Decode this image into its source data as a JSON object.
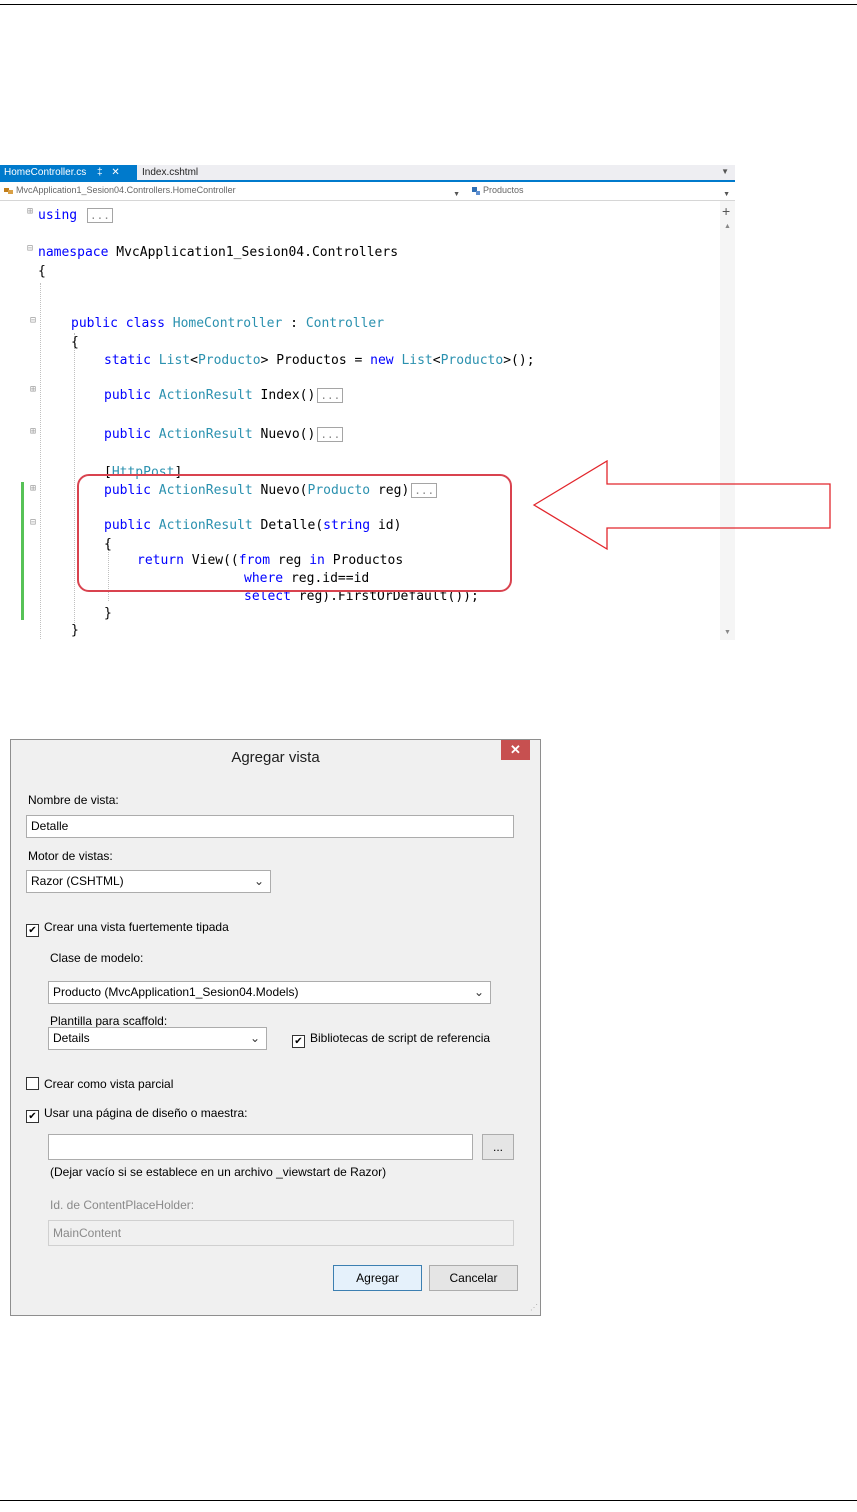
{
  "editor": {
    "tabs": [
      {
        "label": "HomeController.cs",
        "pin": "‡",
        "close": "✕",
        "active": true
      },
      {
        "label": "Index.cshtml",
        "active": false
      }
    ],
    "nav_left": "MvcApplication1_Sesion04.Controllers.HomeController",
    "nav_right": "Productos",
    "code": {
      "l1_kw": "using",
      "collapsed": "...",
      "l2_kw": "namespace",
      "l2_name": " MvcApplication1_Sesion04.Controllers",
      "open_brace": "{",
      "close_brace": "}",
      "l4_kw": "public class",
      "l4_type": "HomeController",
      "l4_sep": " : ",
      "l4_base": "Controller",
      "l6_kw": "static",
      "l6_type1": "List",
      "l6_t1": "<",
      "l6_type2": "Producto",
      "l6_t2": "> Productos = ",
      "l6_kw2": "new",
      "l6_type3": "List",
      "l6_t3": "<",
      "l6_type4": "Producto",
      "l6_t4": ">();",
      "kw_public": "public",
      "type_actionresult": "ActionResult",
      "index_sig": " Index()",
      "nuevo_sig": " Nuevo()",
      "attr_open": "[",
      "attr_name": "HttpPost",
      "attr_close": "]",
      "nuevo2_sig_a": " Nuevo(",
      "nuevo2_type": "Producto",
      "nuevo2_sig_b": " reg)",
      "detalle_sig_a": " Detalle(",
      "detalle_kw": "string",
      "detalle_sig_b": " id)",
      "return_kw": "return",
      "return_a": " View((",
      "from_kw": "from",
      "from_b": " reg ",
      "in_kw": "in",
      "in_b": " Productos",
      "where_kw": "where",
      "where_b": " reg.id==id",
      "select_kw": "select",
      "select_b": " reg).FirstOrDefault());"
    }
  },
  "dialog": {
    "title": "Agregar vista",
    "close_glyph": "✕",
    "view_name_label": "Nombre de vista:",
    "view_name_value": "Detalle",
    "engine_label": "Motor de vistas:",
    "engine_value": "Razor (CSHTML)",
    "strongly_typed_label": "Crear una vista fuertemente tipada",
    "strongly_typed_checked": true,
    "model_class_label": "Clase de modelo:",
    "model_class_value": "Producto (MvcApplication1_Sesion04.Models)",
    "scaffold_label": "Plantilla para scaffold:",
    "scaffold_value": "Details",
    "script_libs_label": "Bibliotecas de script de referencia",
    "script_libs_checked": true,
    "partial_label": "Crear como vista parcial",
    "partial_checked": false,
    "layout_label": "Usar una página de diseño o maestra:",
    "layout_checked": true,
    "layout_value": "",
    "browse_label": "...",
    "layout_hint": "(Dejar vacío si se establece en un archivo _viewstart de Razor)",
    "placeholder_id_label": "Id. de ContentPlaceHolder:",
    "placeholder_id_value": "MainContent",
    "add_button": "Agregar",
    "cancel_button": "Cancelar",
    "check_glyph": "✔"
  },
  "colors": {
    "accent": "#007acc",
    "keyword": "#0000ff",
    "type": "#2b91af",
    "highlight": "#d9434f",
    "close": "#c75050"
  }
}
